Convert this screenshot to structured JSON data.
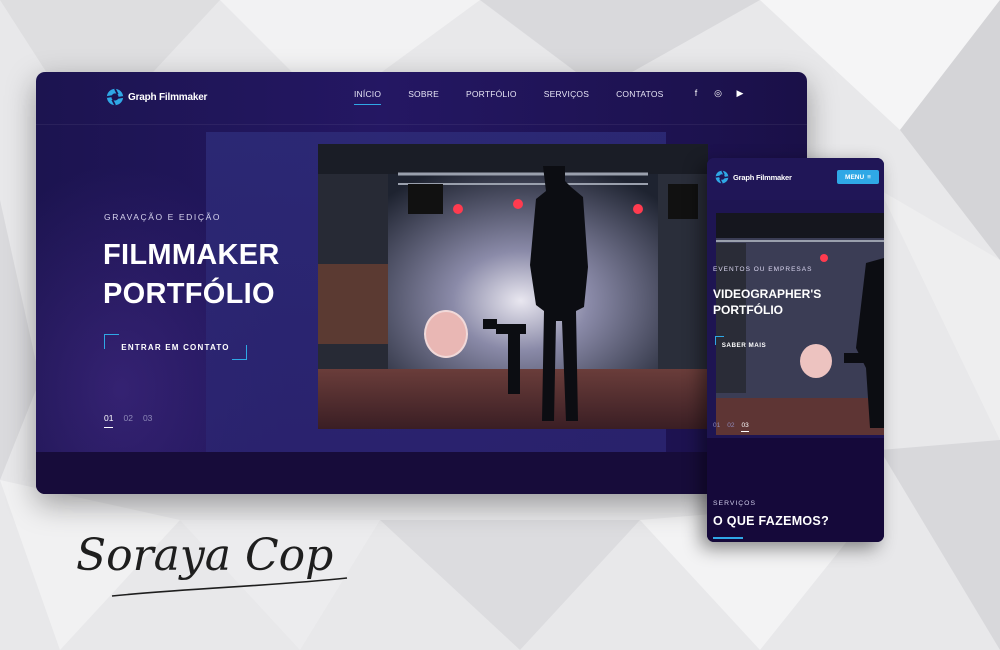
{
  "brand": {
    "name": "Graph Filmmaker",
    "accent": "#2fa8e6",
    "bg": "#241763"
  },
  "desktop": {
    "nav": {
      "items": [
        {
          "label": "INÍCIO",
          "active": true
        },
        {
          "label": "SOBRE",
          "active": false
        },
        {
          "label": "PORTFÓLIO",
          "active": false
        },
        {
          "label": "SERVIÇOS",
          "active": false
        },
        {
          "label": "CONTATOS",
          "active": false
        }
      ],
      "social": [
        {
          "icon": "facebook-icon",
          "glyph": "f"
        },
        {
          "icon": "instagram-icon",
          "glyph": "◎"
        },
        {
          "icon": "youtube-icon",
          "glyph": "▶"
        }
      ]
    },
    "hero": {
      "eyebrow": "GRAVAÇÃO E EDIÇÃO",
      "title_line1": "FILMMAKER",
      "title_line2": "PORTFÓLIO",
      "cta": "ENTRAR EM CONTATO",
      "slides": [
        "01",
        "02",
        "03"
      ],
      "active_slide": 0
    }
  },
  "mobile": {
    "menu_button": "MENU",
    "hero": {
      "eyebrow": "EVENTOS OU EMPRESAS",
      "title_line1": "VIDEOGRAPHER'S",
      "title_line2": "PORTFÓLIO",
      "cta": "SABER MAIS",
      "slides": [
        "01",
        "02",
        "03"
      ],
      "active_slide": 2
    },
    "section": {
      "eyebrow": "SERVIÇOS",
      "title": "O QUE FAZEMOS?"
    }
  },
  "signature": "Soraya Cop"
}
